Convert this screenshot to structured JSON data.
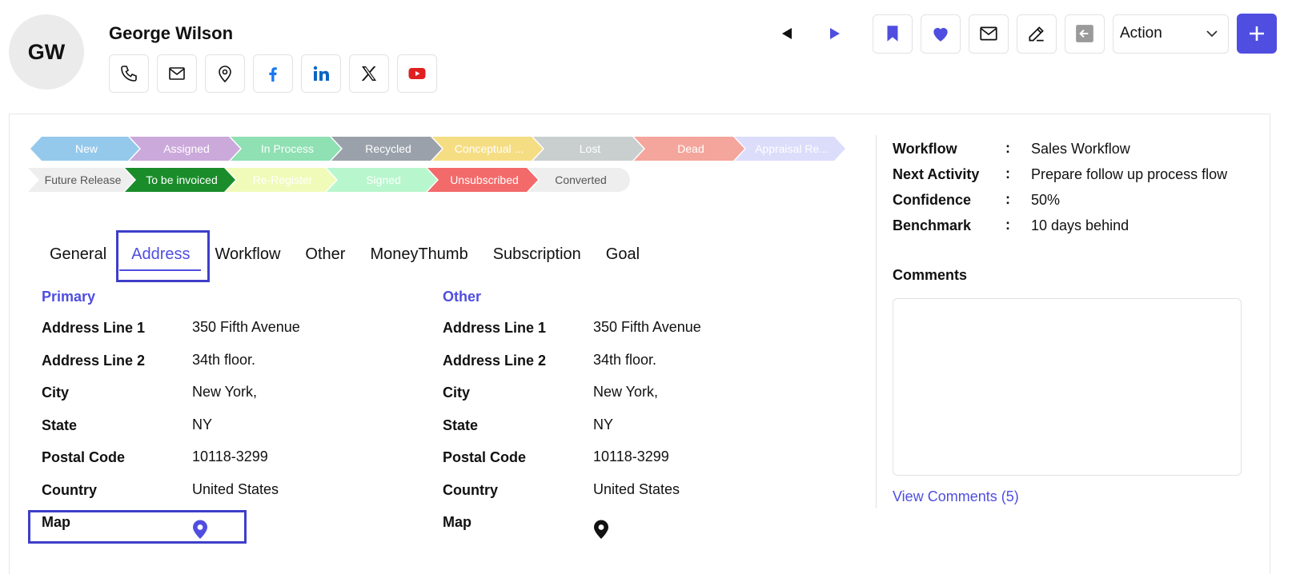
{
  "contact": {
    "initials": "GW",
    "name": "George Wilson"
  },
  "social_icons": [
    "phone-icon",
    "mail-icon",
    "location-icon",
    "facebook-icon",
    "linkedin-icon",
    "x-icon",
    "youtube-icon"
  ],
  "toolbar": {
    "action_label": "Action",
    "accent_color": "#4f4ee0"
  },
  "stages_row1": [
    {
      "label": "New",
      "color": "#95c9ec"
    },
    {
      "label": "Assigned",
      "color": "#cba9db"
    },
    {
      "label": "In Process",
      "color": "#8fe0b3"
    },
    {
      "label": "Recycled",
      "color": "#9aa1aa"
    },
    {
      "label": "Conceptual ...",
      "color": "#f5dd84"
    },
    {
      "label": "Lost",
      "color": "#c9cfcf"
    },
    {
      "label": "Dead",
      "color": "#f4a59c"
    },
    {
      "label": "Appraisal Re...",
      "color": "#dcdcfb"
    }
  ],
  "stages_row2": [
    {
      "label": "Future Release",
      "color": "#eeeeee",
      "text": "#555555"
    },
    {
      "label": "To be invoiced",
      "color": "#1a8c2a",
      "text": "#ffffff"
    },
    {
      "label": "Re-Register",
      "color": "#f0fbb9",
      "text": "#ffffff"
    },
    {
      "label": "Signed",
      "color": "#b8f6cd",
      "text": "#ffffff"
    },
    {
      "label": "Unsubscribed",
      "color": "#f36a6a",
      "text": "#ffffff"
    },
    {
      "label": "Converted",
      "color": "#eeeeee",
      "text": "#555555"
    }
  ],
  "tabs": [
    "General",
    "Address",
    "Workflow",
    "Other",
    "MoneyThumb",
    "Subscription",
    "Goal"
  ],
  "address": {
    "primary": {
      "title": "Primary",
      "fields": [
        {
          "label": "Address Line 1",
          "value": "350 Fifth Avenue"
        },
        {
          "label": "Address Line 2",
          "value": "34th floor."
        },
        {
          "label": "City",
          "value": "New York,"
        },
        {
          "label": "State",
          "value": "NY"
        },
        {
          "label": "Postal Code",
          "value": "10118-3299"
        },
        {
          "label": "Country",
          "value": "United States"
        },
        {
          "label": "Map",
          "value": ""
        }
      ]
    },
    "other": {
      "title": "Other",
      "fields": [
        {
          "label": "Address Line 1",
          "value": "350 Fifth Avenue"
        },
        {
          "label": "Address Line 2",
          "value": "34th floor."
        },
        {
          "label": "City",
          "value": "New York,"
        },
        {
          "label": "State",
          "value": "NY"
        },
        {
          "label": "Postal Code",
          "value": "10118-3299"
        },
        {
          "label": "Country",
          "value": "United States"
        },
        {
          "label": "Map",
          "value": ""
        }
      ]
    }
  },
  "info": [
    {
      "label": "Workflow",
      "value": "Sales Workflow"
    },
    {
      "label": "Next Activity",
      "value": "Prepare follow up process flow"
    },
    {
      "label": "Confidence",
      "value": "50%"
    },
    {
      "label": "Benchmark",
      "value": "10 days behind"
    }
  ],
  "comments": {
    "label": "Comments",
    "view_link": "View Comments (5)"
  }
}
